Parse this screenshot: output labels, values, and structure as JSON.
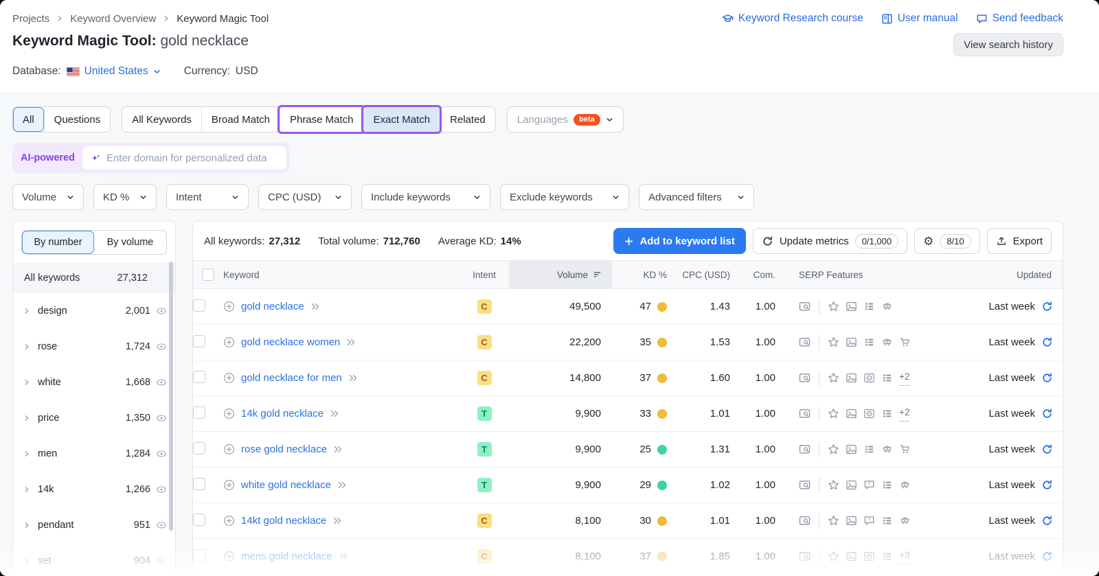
{
  "breadcrumb": {
    "items": [
      "Projects",
      "Keyword Overview",
      "Keyword Magic Tool"
    ]
  },
  "top_links": [
    {
      "label": "Keyword Research course",
      "icon": "graduation-cap"
    },
    {
      "label": "User manual",
      "icon": "book"
    },
    {
      "label": "Send feedback",
      "icon": "chat"
    }
  ],
  "title": {
    "main": "Keyword Magic Tool:",
    "query": "gold necklace"
  },
  "view_history_label": "View search history",
  "meta": {
    "database_label": "Database:",
    "database_value": "United States",
    "currency_label": "Currency:",
    "currency_value": "USD"
  },
  "tabs": {
    "group1": [
      {
        "label": "All",
        "selected": true
      },
      {
        "label": "Questions"
      }
    ],
    "group2": [
      {
        "label": "All Keywords"
      },
      {
        "label": "Broad Match"
      },
      {
        "label": "Phrase Match",
        "annotated": true
      },
      {
        "label": "Exact Match",
        "annotated": true,
        "filled": true
      },
      {
        "label": "Related"
      }
    ],
    "languages": {
      "label": "Languages",
      "badge": "beta"
    }
  },
  "ai_bar": {
    "label": "AI-powered",
    "placeholder": "Enter domain for personalized data"
  },
  "filters": [
    "Volume",
    "KD %",
    "Intent",
    "CPC (USD)",
    "Include keywords",
    "Exclude keywords",
    "Advanced filters"
  ],
  "sidebar": {
    "toggle": [
      {
        "label": "By number",
        "selected": true
      },
      {
        "label": "By volume"
      }
    ],
    "all_row": {
      "label": "All keywords",
      "count": "27,312"
    },
    "groups": [
      {
        "name": "design",
        "count": "2,001"
      },
      {
        "name": "rose",
        "count": "1,724"
      },
      {
        "name": "white",
        "count": "1,668"
      },
      {
        "name": "price",
        "count": "1,350"
      },
      {
        "name": "men",
        "count": "1,284"
      },
      {
        "name": "14k",
        "count": "1,266"
      },
      {
        "name": "pendant",
        "count": "951"
      },
      {
        "name": "set",
        "count": "904",
        "muted": true
      }
    ]
  },
  "stats": [
    {
      "label": "All keywords:",
      "value": "27,312"
    },
    {
      "label": "Total volume:",
      "value": "712,760"
    },
    {
      "label": "Average KD:",
      "value": "14%"
    }
  ],
  "actions": {
    "add_label": "Add to keyword list",
    "update_label": "Update metrics",
    "update_count": "0/1,000",
    "settings_count": "8/10",
    "export_label": "Export"
  },
  "table": {
    "columns": [
      "Keyword",
      "Intent",
      "Volume",
      "KD %",
      "CPC (USD)",
      "Com.",
      "SERP Features",
      "Updated"
    ],
    "rows": [
      {
        "keyword": "gold necklace",
        "intent": "C",
        "volume": "49,500",
        "kd": "47",
        "kd_level": "medium",
        "cpc": "1.43",
        "com": "1.00",
        "serp": [
          "star",
          "image",
          "list",
          "cart"
        ],
        "extra": "",
        "updated": "Last week"
      },
      {
        "keyword": "gold necklace women",
        "intent": "C",
        "volume": "22,200",
        "kd": "35",
        "kd_level": "medium",
        "cpc": "1.53",
        "com": "1.00",
        "serp": [
          "star",
          "image",
          "list",
          "cart",
          "cart2"
        ],
        "extra": "",
        "updated": "Last week"
      },
      {
        "keyword": "gold necklace for men",
        "intent": "C",
        "volume": "14,800",
        "kd": "37",
        "kd_level": "medium",
        "cpc": "1.60",
        "com": "1.00",
        "serp": [
          "star",
          "image",
          "video",
          "list"
        ],
        "extra": "+2",
        "updated": "Last week"
      },
      {
        "keyword": "14k gold necklace",
        "intent": "T",
        "volume": "9,900",
        "kd": "33",
        "kd_level": "medium",
        "cpc": "1.01",
        "com": "1.00",
        "serp": [
          "star",
          "image",
          "video",
          "list"
        ],
        "extra": "+2",
        "updated": "Last week"
      },
      {
        "keyword": "rose gold necklace",
        "intent": "T",
        "volume": "9,900",
        "kd": "25",
        "kd_level": "easy",
        "cpc": "1.31",
        "com": "1.00",
        "serp": [
          "star",
          "image",
          "list",
          "cart",
          "cart2"
        ],
        "extra": "",
        "updated": "Last week"
      },
      {
        "keyword": "white gold necklace",
        "intent": "T",
        "volume": "9,900",
        "kd": "29",
        "kd_level": "easy",
        "cpc": "1.02",
        "com": "1.00",
        "serp": [
          "star",
          "image",
          "faq",
          "list",
          "cart"
        ],
        "extra": "",
        "updated": "Last week"
      },
      {
        "keyword": "14kt gold necklace",
        "intent": "C",
        "volume": "8,100",
        "kd": "30",
        "kd_level": "medium",
        "cpc": "1.01",
        "com": "1.00",
        "serp": [
          "star",
          "image",
          "faq",
          "list",
          "cart"
        ],
        "extra": "",
        "updated": "Last week"
      },
      {
        "keyword": "mens gold necklace",
        "intent": "C",
        "volume": "8,100",
        "kd": "37",
        "kd_level": "medium",
        "cpc": "1.85",
        "com": "1.00",
        "serp": [
          "star",
          "image",
          "video",
          "list"
        ],
        "extra": "+3",
        "updated": "Last week",
        "muted": true
      }
    ]
  },
  "colors": {
    "accent_blue": "#2a6be0",
    "annotation_purple": "#9a57e9",
    "beta_orange": "#f4511e",
    "kd_medium": "#f2ba38",
    "kd_easy": "#3fd3a0",
    "intent_commercial_bg": "#f9df83",
    "intent_transactional_bg": "#8ef0c5"
  }
}
